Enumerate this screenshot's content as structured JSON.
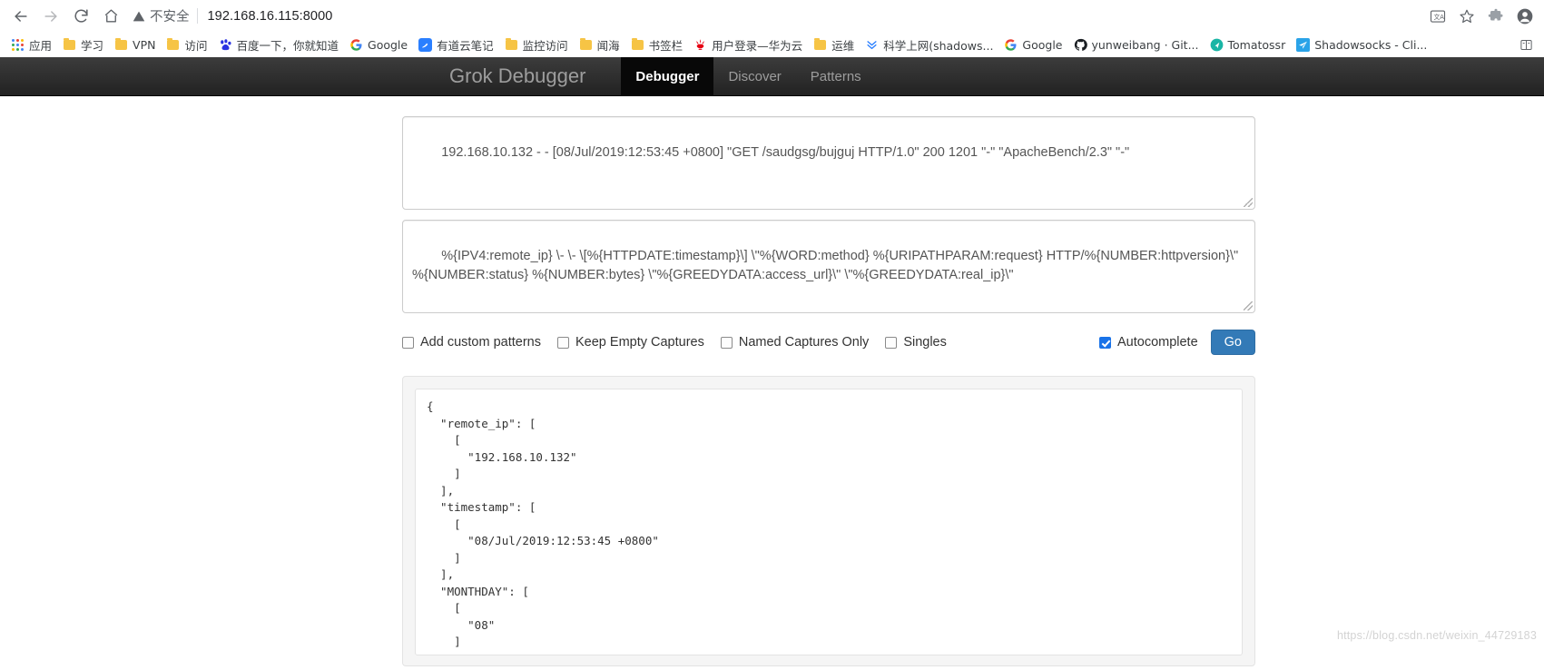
{
  "browser": {
    "back_icon": "arrow-left-icon",
    "forward_icon": "arrow-right-icon",
    "reload_icon": "reload-icon",
    "home_icon": "home-icon",
    "security_warning_icon": "warning-triangle-icon",
    "security_label": "不安全",
    "url": "192.168.16.115:8000",
    "right_icons": [
      "translate-icon",
      "bookmark-star-icon",
      "extension-icon",
      "profile-avatar-icon"
    ]
  },
  "bookmarks": [
    {
      "label": "应用",
      "icon": "apps-grid-icon"
    },
    {
      "label": "学习",
      "icon": "folder-icon"
    },
    {
      "label": "VPN",
      "icon": "folder-icon"
    },
    {
      "label": "访问",
      "icon": "folder-icon"
    },
    {
      "label": "百度一下，你就知道",
      "icon": "baidu-paw-icon"
    },
    {
      "label": "Google",
      "icon": "google-g-icon"
    },
    {
      "label": "有道云笔记",
      "icon": "youdao-note-icon"
    },
    {
      "label": "监控访问",
      "icon": "folder-icon"
    },
    {
      "label": "闻海",
      "icon": "folder-icon"
    },
    {
      "label": "书签栏",
      "icon": "folder-icon"
    },
    {
      "label": "用户登录—华为云",
      "icon": "huawei-flower-icon"
    },
    {
      "label": "运维",
      "icon": "folder-icon"
    },
    {
      "label": "科学上网(shadows...",
      "icon": "double-chevron-down-icon"
    },
    {
      "label": "Google",
      "icon": "google-g-icon"
    },
    {
      "label": "yunweibang · Git...",
      "icon": "github-icon"
    },
    {
      "label": "Tomatossr",
      "icon": "tomato-circle-icon"
    },
    {
      "label": "Shadowsocks - Cli...",
      "icon": "paper-plane-icon"
    }
  ],
  "bookmarks_overflow_icon": "bookmark-list-icon",
  "app": {
    "brand": "Grok Debugger",
    "nav": [
      {
        "label": "Debugger",
        "active": true
      },
      {
        "label": "Discover",
        "active": false
      },
      {
        "label": "Patterns",
        "active": false
      }
    ]
  },
  "debugger": {
    "sample_input": "192.168.10.132 - - [08/Jul/2019:12:53:45 +0800] \"GET /saudgsg/bujguj HTTP/1.0\" 200 1201 \"-\" \"ApacheBench/2.3\" \"-\"",
    "sample_placeholder": "",
    "pattern_input": "%{IPV4:remote_ip} \\- \\- \\[%{HTTPDATE:timestamp}\\] \\\"%{WORD:method} %{URIPATHPARAM:request} HTTP/%{NUMBER:httpversion}\\\" %{NUMBER:status} %{NUMBER:bytes} \\\"%{GREEDYDATA:access_url}\\\" \\\"%{GREEDYDATA:real_ip}\\\"",
    "pattern_placeholder": "",
    "options": [
      {
        "label": "Add custom patterns",
        "checked": false
      },
      {
        "label": "Keep Empty Captures",
        "checked": false
      },
      {
        "label": "Named Captures Only",
        "checked": false
      },
      {
        "label": "Singles",
        "checked": false
      }
    ],
    "autocomplete": {
      "label": "Autocomplete",
      "checked": true
    },
    "go_label": "Go",
    "output": "{\n  \"remote_ip\": [\n    [\n      \"192.168.10.132\"\n    ]\n  ],\n  \"timestamp\": [\n    [\n      \"08/Jul/2019:12:53:45 +0800\"\n    ]\n  ],\n  \"MONTHDAY\": [\n    [\n      \"08\"\n    ]"
  },
  "watermark": "https://blog.csdn.net/weixin_44729183",
  "colors": {
    "accent": "#337ab7",
    "checkbox_checked": "#1a73e8",
    "navbar_dark": "#222222",
    "folder_yellow": "#f6c445"
  }
}
